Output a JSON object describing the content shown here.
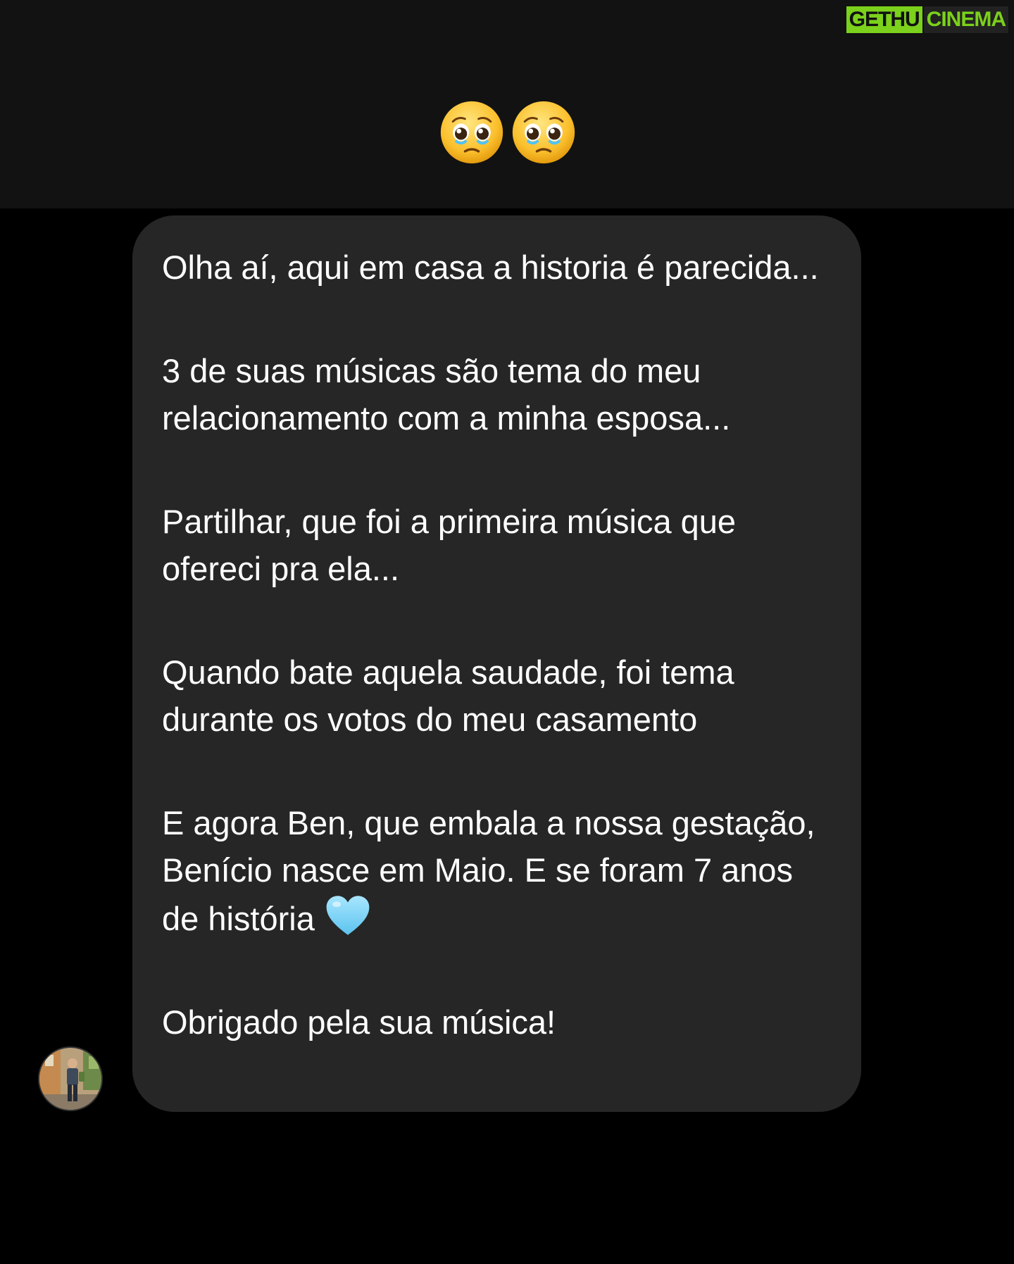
{
  "watermark": {
    "part_a": "GETHU",
    "part_b": "CINEMA"
  },
  "reaction": {
    "emojis": [
      "pleading-face-icon",
      "pleading-face-icon"
    ]
  },
  "message": {
    "paragraphs": [
      "Olha aí, aqui em casa a historia é parecida...",
      "3 de suas músicas são tema do meu relacionamento com a minha esposa...",
      "Partilhar, que foi a primeira música que ofereci pra ela...",
      "Quando bate aquela saudade, foi tema durante os votos do meu casamento",
      "E agora Ben, que embala a nossa gestação, Benício nasce em Maio. E se foram 7 anos de história",
      "Obrigado pela sua música!"
    ],
    "trailing_emoji": "light-blue-heart-icon"
  },
  "colors": {
    "background": "#000000",
    "top_panel": "#121212",
    "bubble": "#262626",
    "text": "#ffffff",
    "watermark_green": "#7bd11b",
    "heart": "#7fd6f5"
  }
}
